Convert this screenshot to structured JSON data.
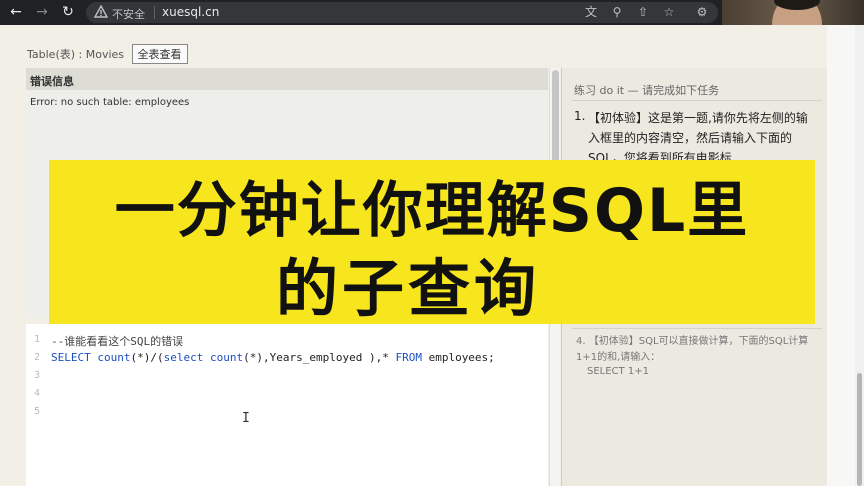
{
  "browser": {
    "insecure_label": "不安全",
    "url": "xuesql.cn"
  },
  "table_bar": {
    "label": "Table(表) : Movies",
    "view_all_button": "全表查看"
  },
  "error_panel": {
    "title": "错误信息",
    "message": "Error: no such table: employees"
  },
  "task_panel": {
    "header": "练习 do it — 请完成如下任务",
    "task1_number": "1.",
    "task1_text": "【初体验】这是第一题,请你先将左侧的输入框里的内容清空，然后请输入下面的SQL，您将看到所有电影标",
    "task4_text": "4. 【初体验】SQL可以直接做计算，下面的SQL计算1+1的和,请输入：",
    "task4_code": "SELECT 1+1"
  },
  "editor": {
    "line_numbers": [
      "1",
      "2",
      "3",
      "4",
      "5"
    ],
    "line1_comment": "--谁能看看这个SQL的错误",
    "line2": {
      "kw_select": "SELECT",
      "kw_count1": "count",
      "part1": "(*)/(",
      "kw_select2": "select",
      "kw_count2": "count",
      "part2": "(*),Years_employed ),* ",
      "kw_from": "FROM",
      "part3": " employees;"
    }
  },
  "banner": {
    "line1": "一分钟让你理解SQL里",
    "line2": "的子查询"
  },
  "colors": {
    "banner_bg": "#f7e51d",
    "keyword": "#1d4fc4",
    "chrome_bg": "#202124"
  }
}
